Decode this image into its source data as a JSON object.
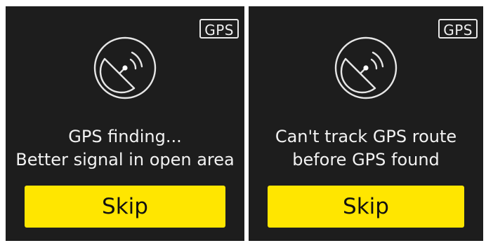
{
  "colors": {
    "screen_background": "#1d1d1d",
    "text": "#f2f2f2",
    "button": "#ffe600",
    "button_text": "#111111"
  },
  "left_screen": {
    "badge": "GPS",
    "icon": "satellite-dish-icon",
    "message_line1": "GPS finding...",
    "message_line2": "Better signal in open area",
    "skip_label": "Skip"
  },
  "right_screen": {
    "badge": "GPS",
    "icon": "satellite-dish-icon",
    "message_line1": "Can't track GPS route",
    "message_line2": "before GPS found",
    "skip_label": "Skip"
  }
}
